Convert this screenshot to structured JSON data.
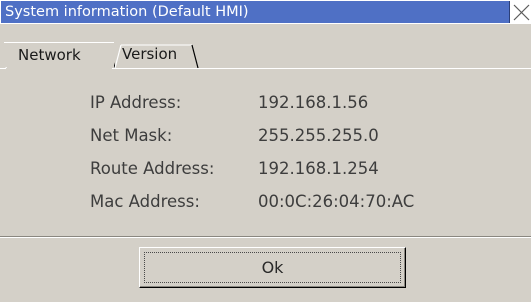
{
  "window": {
    "title": "System information (Default HMI)",
    "accent_color": "#4f70c5"
  },
  "tabs": [
    {
      "label": "Network",
      "selected": true
    },
    {
      "label": "Version",
      "selected": false
    }
  ],
  "network": {
    "rows": [
      {
        "label": "IP Address:",
        "value": "192.168.1.56"
      },
      {
        "label": "Net Mask:",
        "value": "255.255.255.0"
      },
      {
        "label": "Route Address:",
        "value": "192.168.1.254"
      },
      {
        "label": "Mac Address:",
        "value": "00:0C:26:04:70:AC"
      }
    ]
  },
  "buttons": {
    "ok_label": "Ok"
  },
  "icons": {
    "close": "close-icon"
  }
}
